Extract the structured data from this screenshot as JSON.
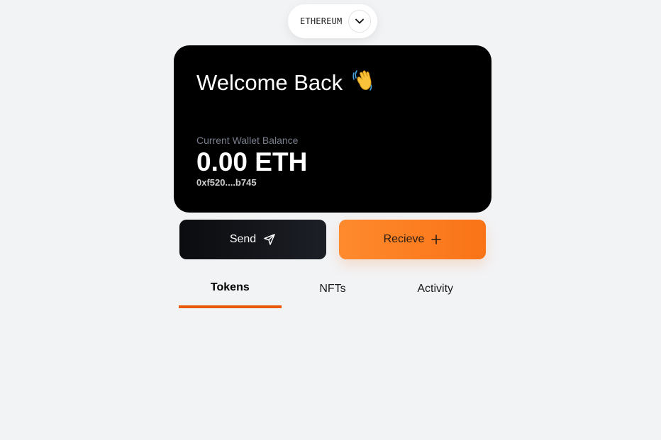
{
  "network": {
    "label": "ETHEREUM",
    "dropdown_icon": "chevron-down-icon"
  },
  "card": {
    "welcome": "Welcome Back",
    "wave_icon": "waving-hand-icon",
    "balance_label": "Current Wallet Balance",
    "balance_value": "0.00 ETH",
    "address": "0xf520....b745"
  },
  "actions": {
    "send_label": "Send",
    "send_icon": "paper-plane-icon",
    "receive_label": "Recieve",
    "receive_icon": "plus-icon"
  },
  "tabs": [
    {
      "label": "Tokens",
      "active": true
    },
    {
      "label": "NFTs",
      "active": false
    },
    {
      "label": "Activity",
      "active": false
    }
  ],
  "colors": {
    "background": "#f2f3f5",
    "card": "#000000",
    "accent": "#ea580c",
    "receive_button": "#f97316"
  }
}
